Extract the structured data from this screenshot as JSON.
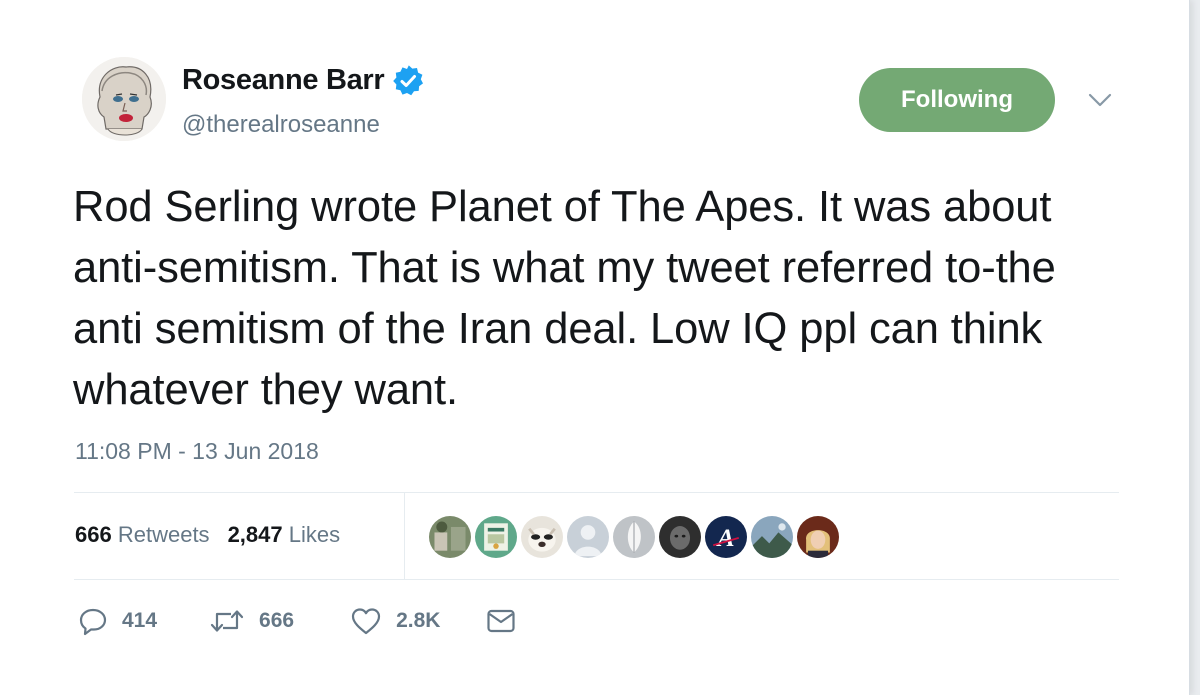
{
  "user": {
    "display_name": "Roseanne Barr",
    "handle": "@therealroseanne",
    "verified": true
  },
  "follow_button": {
    "label": "Following",
    "color": "#74a974"
  },
  "tweet": {
    "text": "Rod Serling wrote Planet of The Apes. It was about anti-semitism. That is what my tweet referred to-the anti semitism of the Iran deal. Low IQ ppl can think whatever they want.",
    "timestamp": "11:08 PM - 13 Jun 2018"
  },
  "stats": {
    "retweets": {
      "count": "666",
      "label": "Retweets"
    },
    "likes": {
      "count": "2,847",
      "label": "Likes"
    }
  },
  "liker_avatars": [
    {
      "icon": "outdoor-photo-avatar",
      "bg": "#7a8a6a"
    },
    {
      "icon": "poster-avatar",
      "bg": "#5fa88a"
    },
    {
      "icon": "bulldog-avatar",
      "bg": "#e8e4dc"
    },
    {
      "icon": "default-person-avatar",
      "bg": "#c8d0d8"
    },
    {
      "icon": "white-shape-avatar",
      "bg": "#bfc3c7"
    },
    {
      "icon": "dark-face-avatar",
      "bg": "#2e2e2e"
    },
    {
      "icon": "braves-logo-avatar",
      "bg": "#13274f"
    },
    {
      "icon": "landscape-avatar",
      "bg": "#6f8aa0"
    },
    {
      "icon": "blonde-person-avatar",
      "bg": "#6b2a1a"
    }
  ],
  "actions": {
    "reply": {
      "icon": "reply-icon",
      "count": "414"
    },
    "retweet": {
      "icon": "retweet-icon",
      "count": "666"
    },
    "like": {
      "icon": "heart-icon",
      "count": "2.8K"
    },
    "message": {
      "icon": "envelope-icon"
    }
  },
  "colors": {
    "text_primary": "#14171a",
    "text_secondary": "#657786",
    "verified_blue": "#1da1f2"
  }
}
